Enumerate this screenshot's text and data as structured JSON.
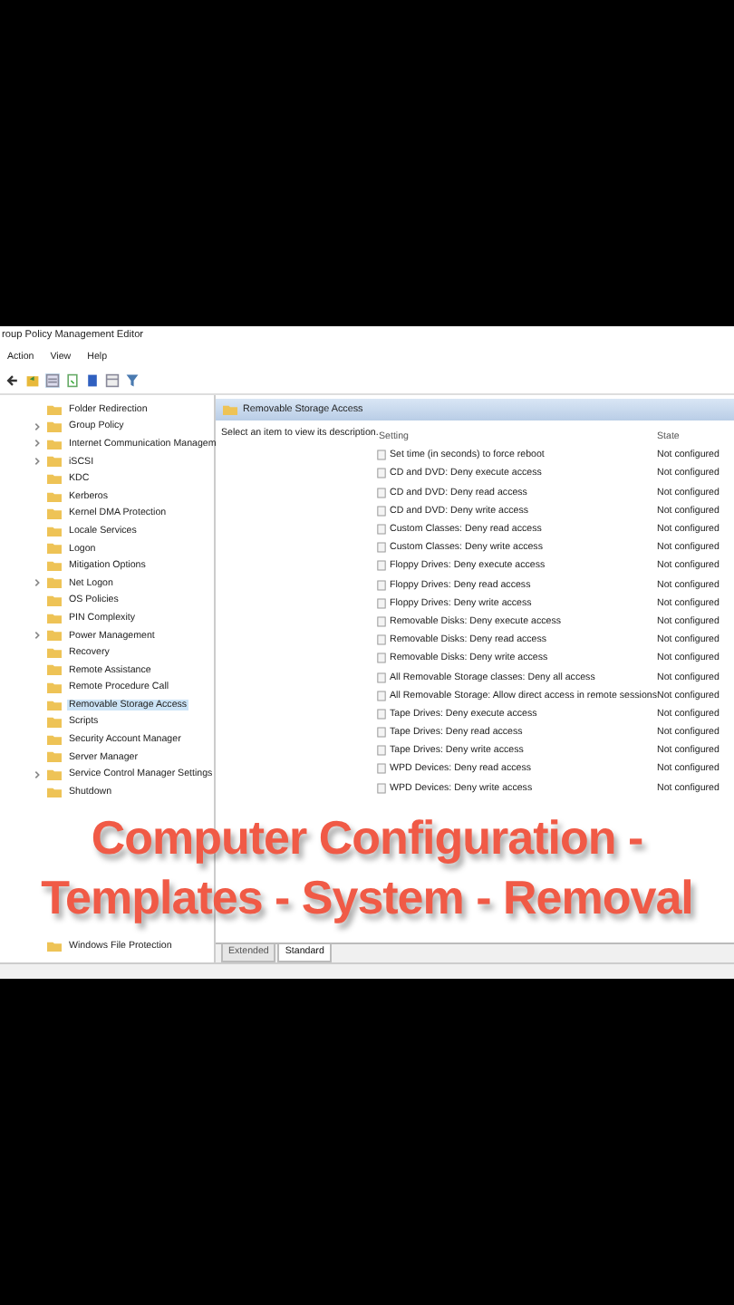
{
  "window": {
    "title": "roup Policy Management Editor"
  },
  "menu": [
    "Action",
    "View",
    "Help"
  ],
  "tree": {
    "items": [
      {
        "label": "Folder Redirection",
        "has_children": false,
        "selected": false
      },
      {
        "label": "Group Policy",
        "has_children": true,
        "selected": false
      },
      {
        "label": "Internet Communication Managem",
        "has_children": true,
        "selected": false
      },
      {
        "label": "iSCSI",
        "has_children": true,
        "selected": false
      },
      {
        "label": "KDC",
        "has_children": false,
        "selected": false
      },
      {
        "label": "Kerberos",
        "has_children": false,
        "selected": false
      },
      {
        "label": "Kernel DMA Protection",
        "has_children": false,
        "selected": false
      },
      {
        "label": "Locale Services",
        "has_children": false,
        "selected": false
      },
      {
        "label": "Logon",
        "has_children": false,
        "selected": false
      },
      {
        "label": "Mitigation Options",
        "has_children": false,
        "selected": false
      },
      {
        "label": "Net Logon",
        "has_children": true,
        "selected": false
      },
      {
        "label": "OS Policies",
        "has_children": false,
        "selected": false
      },
      {
        "label": "PIN Complexity",
        "has_children": false,
        "selected": false
      },
      {
        "label": "Power Management",
        "has_children": true,
        "selected": false
      },
      {
        "label": "Recovery",
        "has_children": false,
        "selected": false
      },
      {
        "label": "Remote Assistance",
        "has_children": false,
        "selected": false
      },
      {
        "label": "Remote Procedure Call",
        "has_children": false,
        "selected": false
      },
      {
        "label": "Removable Storage Access",
        "has_children": false,
        "selected": true
      },
      {
        "label": "Scripts",
        "has_children": false,
        "selected": false
      },
      {
        "label": "Security Account Manager",
        "has_children": false,
        "selected": false
      },
      {
        "label": "Server Manager",
        "has_children": false,
        "selected": false
      },
      {
        "label": "Service Control Manager Settings",
        "has_children": true,
        "selected": false
      },
      {
        "label": "Shutdown",
        "has_children": false,
        "selected": false
      },
      {
        "label": "Windows File Protection",
        "has_children": false,
        "selected": false
      }
    ]
  },
  "details": {
    "header": "Removable Storage Access",
    "description": "Select an item to view its description.",
    "columns": [
      "Setting",
      "State"
    ],
    "rows": [
      {
        "setting": "Set time (in seconds) to force reboot",
        "state": "Not configured"
      },
      {
        "setting": "CD and DVD: Deny execute access",
        "state": "Not configured"
      },
      {
        "setting": "CD and DVD: Deny read access",
        "state": "Not configured"
      },
      {
        "setting": "CD and DVD: Deny write access",
        "state": "Not configured"
      },
      {
        "setting": "Custom Classes: Deny read access",
        "state": "Not configured"
      },
      {
        "setting": "Custom Classes: Deny write access",
        "state": "Not configured"
      },
      {
        "setting": "Floppy Drives: Deny execute access",
        "state": "Not configured"
      },
      {
        "setting": "Floppy Drives: Deny read access",
        "state": "Not configured"
      },
      {
        "setting": "Floppy Drives: Deny write access",
        "state": "Not configured"
      },
      {
        "setting": "Removable Disks: Deny execute access",
        "state": "Not configured"
      },
      {
        "setting": "Removable Disks: Deny read access",
        "state": "Not configured"
      },
      {
        "setting": "Removable Disks: Deny write access",
        "state": "Not configured"
      },
      {
        "setting": "All Removable Storage classes: Deny all access",
        "state": "Not configured"
      },
      {
        "setting": "All Removable Storage: Allow direct access in remote sessions",
        "state": "Not configured"
      },
      {
        "setting": "Tape Drives: Deny execute access",
        "state": "Not configured"
      },
      {
        "setting": "Tape Drives: Deny read access",
        "state": "Not configured"
      },
      {
        "setting": "Tape Drives: Deny write access",
        "state": "Not configured"
      },
      {
        "setting": "WPD Devices: Deny read access",
        "state": "Not configured"
      },
      {
        "setting": "WPD Devices: Deny write access",
        "state": "Not configured"
      }
    ]
  },
  "tabs": [
    {
      "label": "Extended",
      "selected": false
    },
    {
      "label": "Standard",
      "selected": true
    }
  ],
  "caption": [
    "Computer Configuration -",
    "Templates - System - Removal"
  ]
}
